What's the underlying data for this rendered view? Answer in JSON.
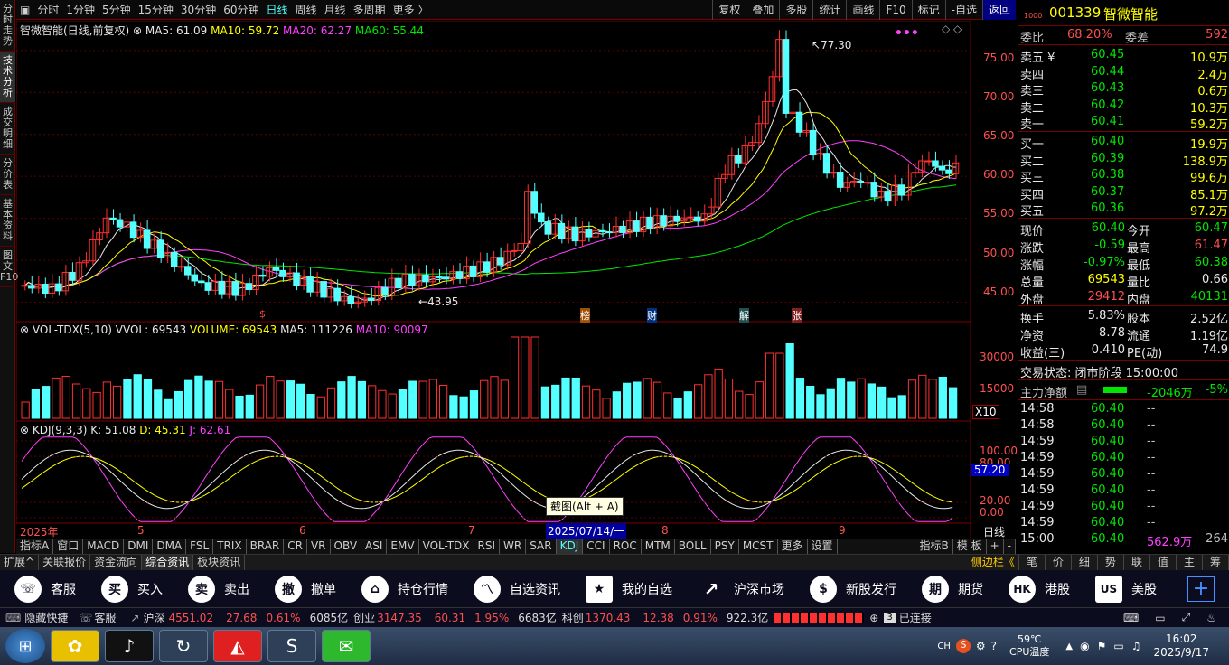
{
  "left_tabs": [
    "分时走势",
    "技术分析",
    "成交明细",
    "分价表",
    "基本资料",
    "图文F10"
  ],
  "toolbar": {
    "periods": [
      "分时",
      "1分钟",
      "5分钟",
      "15分钟",
      "30分钟",
      "60分钟",
      "日线",
      "周线",
      "月线",
      "多周期",
      "更多 〉"
    ],
    "active": "日线",
    "right": [
      "复权",
      "叠加",
      "多股",
      "统计",
      "画线",
      "F10",
      "标记",
      "-自选",
      "返回"
    ]
  },
  "chart_header": {
    "name": "智微智能(日线,前复权)",
    "ma5": "MA5: 61.09",
    "ma10": "MA10: 59.72",
    "ma20": "MA20: 62.27",
    "ma60": "MA60: 55.44"
  },
  "price_axis": {
    "ticks": [
      "75.00",
      "70.00",
      "65.00",
      "60.00",
      "55.00",
      "50.00",
      "45.00"
    ],
    "high_label": "77.30",
    "low_label": "43.95"
  },
  "event_markers": [
    "$",
    "榜",
    "财",
    "解",
    "张"
  ],
  "vol_header": {
    "name": "VOL-TDX(5,10)",
    "vvol": "VVOL: 69543",
    "volume": "VOLUME: 69543",
    "ma5": "MA5: 111226",
    "ma10": "MA10: 90097"
  },
  "vol_axis": {
    "ticks": [
      "30000",
      "15000"
    ],
    "unit": "X10"
  },
  "kdj_header": {
    "name": "KDJ(9,3,3)",
    "k": "K: 51.08",
    "d": "D: 45.31",
    "j": "J: 62.61"
  },
  "kdj_axis": {
    "ticks": [
      "100.00",
      "80.00",
      "57.20",
      "20.00",
      "0.00"
    ]
  },
  "date_axis": {
    "labels": [
      "2025年",
      "5",
      "6",
      "7",
      "2025/07/14/一",
      "8",
      "9"
    ],
    "right": "日线"
  },
  "tooltip": "截图(Alt + A)",
  "bottom_tabs": [
    "指标A",
    "窗口",
    "MACD",
    "DMI",
    "DMA",
    "FSL",
    "TRIX",
    "BRAR",
    "CR",
    "VR",
    "OBV",
    "ASI",
    "EMV",
    "VOL-TDX",
    "RSI",
    "WR",
    "SAR",
    "KDJ",
    "CCI",
    "ROC",
    "MTM",
    "BOLL",
    "PSY",
    "MCST",
    "更多",
    "设置"
  ],
  "bottom_right": [
    "指标B",
    "模 板",
    "+",
    "-"
  ],
  "ext_tabs": [
    "扩展^",
    "关联报价",
    "资金流向",
    "综合资讯",
    "板块资讯"
  ],
  "ext_right": [
    "侧边栏《",
    "笔",
    "价",
    "细",
    "势",
    "联",
    "值",
    "主",
    "筹"
  ],
  "stock": {
    "code": "001339",
    "name": "智微智能",
    "tag": "1000",
    "weibi": {
      "label": "委比",
      "value": "68.20%",
      "label2": "委差",
      "value2": "592"
    },
    "sells": [
      [
        "卖五 ¥",
        "60.45",
        "10.9万"
      ],
      [
        "卖四",
        "60.44",
        "2.4万"
      ],
      [
        "卖三",
        "60.43",
        "0.6万"
      ],
      [
        "卖二",
        "60.42",
        "10.3万"
      ],
      [
        "卖一",
        "60.41",
        "59.2万"
      ]
    ],
    "buys": [
      [
        "买一",
        "60.40",
        "19.9万"
      ],
      [
        "买二",
        "60.39",
        "138.9万"
      ],
      [
        "买三",
        "60.38",
        "99.6万"
      ],
      [
        "买四",
        "60.37",
        "85.1万"
      ],
      [
        "买五",
        "60.36",
        "97.2万"
      ]
    ],
    "quote": [
      [
        "现价",
        "60.40",
        "今开",
        "60.47"
      ],
      [
        "涨跌",
        "-0.59",
        "最高",
        "61.47"
      ],
      [
        "涨幅",
        "-0.97%",
        "最低",
        "60.38"
      ],
      [
        "总量",
        "69543",
        "量比",
        "0.66"
      ],
      [
        "外盘",
        "29412",
        "内盘",
        "40131"
      ]
    ],
    "info": [
      [
        "换手",
        "5.83%",
        "股本",
        "2.52亿"
      ],
      [
        "净资",
        "8.78",
        "流通",
        "1.19亿"
      ],
      [
        "收益(三)",
        "0.410",
        "PE(动)",
        "74.9"
      ]
    ],
    "status": "交易状态: 闭市阶段 15:00:00",
    "flow": {
      "label": "主力净额",
      "value": "-2046万",
      "pct": "-5%"
    },
    "ticks": [
      [
        "14:58",
        "60.40",
        "--"
      ],
      [
        "14:58",
        "60.40",
        "--"
      ],
      [
        "14:59",
        "60.40",
        "--"
      ],
      [
        "14:59",
        "60.40",
        "--"
      ],
      [
        "14:59",
        "60.40",
        "--"
      ],
      [
        "14:59",
        "60.40",
        "--"
      ],
      [
        "14:59",
        "60.40",
        "--"
      ],
      [
        "14:59",
        "60.40",
        "--"
      ],
      [
        "15:00",
        "60.40",
        "562.9万",
        "264"
      ]
    ]
  },
  "quick": [
    [
      "客服",
      "headset-icon"
    ],
    [
      "买入",
      "买"
    ],
    [
      "卖出",
      "卖"
    ],
    [
      "撤单",
      "撤"
    ],
    [
      "持仓行情",
      "house-icon"
    ],
    [
      "自选资讯",
      "chart-icon"
    ],
    [
      "我的自选",
      "star-icon"
    ],
    [
      "沪深市场",
      "trend-icon"
    ],
    [
      "新股发行",
      "$"
    ],
    [
      "期货",
      "期"
    ],
    [
      "港股",
      "HK"
    ],
    [
      "美股",
      "US"
    ]
  ],
  "status_bar": {
    "hide": "隐藏快捷",
    "service": "客服",
    "sh": "沪深",
    "sh_val": "4551.02",
    "sh_chg": "27.68",
    "sh_pct": "0.61%",
    "sh_amt": "6085亿",
    "cy": "创业",
    "cy_val": "3147.35",
    "cy_chg": "60.31",
    "cy_pct": "1.95%",
    "cy_amt": "6683亿",
    "kc": "科创",
    "kc_val": "1370.43",
    "kc_chg": "12.38",
    "kc_pct": "0.91%",
    "kc_amt": "922.3亿",
    "conn": "已连接"
  },
  "taskbar": {
    "temp": "59℃",
    "temp_label": "CPU温度",
    "time": "16:02",
    "date": "2025/9/17",
    "ime": "CH"
  },
  "chart_data": {
    "type": "candlestick",
    "ylim": [
      43,
      78
    ],
    "high": 77.3,
    "low": 43.95
  }
}
